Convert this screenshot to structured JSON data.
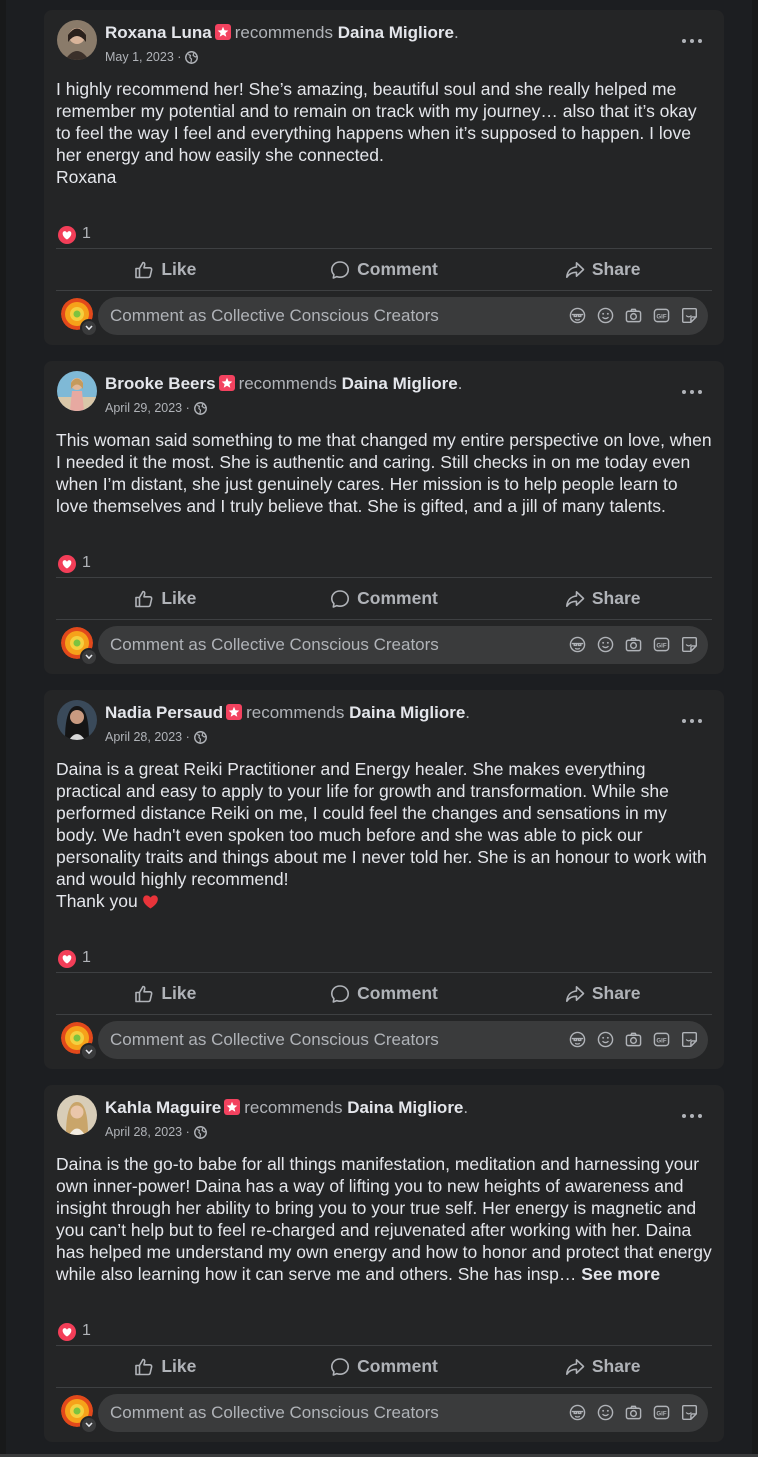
{
  "posts": [
    {
      "author": "Roxana Luna",
      "recommends_text": "recommends",
      "page_name": "Daina Migliore",
      "date": "May 1, 2023",
      "paragraphs": [
        "I highly recommend her! She’s amazing, beautiful soul and she really helped me remember my potential and to remain on track with my journey… also that it’s okay to feel the way I feel and everything happens when it’s supposed to happen. I love her energy and how easily she connected.",
        "Roxana"
      ],
      "reaction_count": "1"
    },
    {
      "author": "Brooke Beers",
      "recommends_text": "recommends",
      "page_name": "Daina Migliore",
      "date": "April 29, 2023",
      "paragraphs": [
        "This woman said something to me that changed my entire perspective on love, when I needed it the most. She is authentic and caring. Still checks in on me today even when I’m distant, she just genuinely cares. Her mission is to help people learn to love themselves and I truly believe that. She is gifted, and a jill of many talents."
      ],
      "reaction_count": "1"
    },
    {
      "author": "Nadia Persaud",
      "recommends_text": "recommends",
      "page_name": "Daina Migliore",
      "date": "April 28, 2023",
      "paragraphs": [
        "Daina is a great Reiki Practitioner and Energy healer. She makes everything practical and easy to apply to your life for growth and transformation. While she performed distance Reiki on me, I could feel the changes and sensations in my body. We hadn't even spoken too much before and she was able to pick our personality traits and things about me I never told her. She is an honour to work with and would highly recommend!",
        "Thank you"
      ],
      "reaction_count": "1"
    },
    {
      "author": "Kahla Maguire",
      "recommends_text": "recommends",
      "page_name": "Daina Migliore",
      "date": "April 28, 2023",
      "paragraphs": [
        "Daina is the go-to babe for all things manifestation, meditation and harnessing your own inner-power! Daina has a way of lifting you to new heights of awareness and insight through her ability to bring you to your true self. Her energy is magnetic and you can’t help but to feel re-charged and rejuvenated after working with her. Daina has helped me understand my own energy and how to honor and protect that energy while also learning how it can serve me and others. She has insp…"
      ],
      "see_more": "See more",
      "reaction_count": "1"
    }
  ],
  "actions": {
    "like": "Like",
    "comment": "Comment",
    "share": "Share"
  },
  "comment_placeholder": "Comment as Collective Conscious Creators",
  "colors": {
    "background": "#1c1e21",
    "card": "#242526",
    "input": "#3a3b3c",
    "primary_text": "#e4e6eb",
    "secondary_text": "#b0b3b8",
    "recommend_badge": "#f3425f",
    "love_react": "#f33e58"
  },
  "icons": {
    "recommend": "recommend-star-icon",
    "privacy": "globe-icon",
    "reaction": "love-reaction-icon",
    "more": "more-options-icon",
    "like": "thumbs-up-icon",
    "comment": "comment-bubble-icon",
    "share": "share-arrow-icon",
    "avatar_menu": "chevron-down-icon",
    "tools": [
      "avatar-sticker-icon",
      "emoji-icon",
      "camera-icon",
      "gif-icon",
      "sticker-icon"
    ]
  }
}
